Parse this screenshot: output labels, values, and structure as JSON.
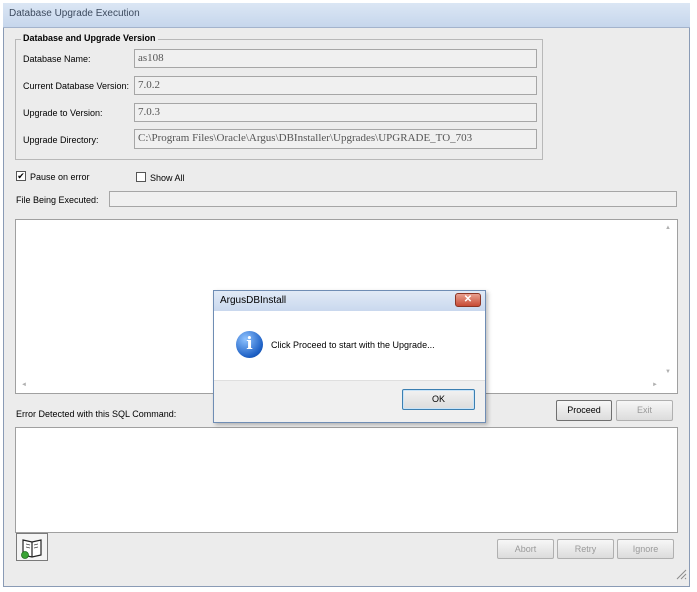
{
  "window": {
    "title": "Database Upgrade Execution"
  },
  "group": {
    "legend": "Database and Upgrade Version",
    "fields": [
      {
        "label": "Database Name:",
        "value": "as108"
      },
      {
        "label": "Current Database Version:",
        "value": "7.0.2"
      },
      {
        "label": "Upgrade to Version:",
        "value": "7.0.3"
      },
      {
        "label": "Upgrade Directory:",
        "value": "C:\\Program Files\\Oracle\\Argus\\DBInstaller\\Upgrades\\UPGRADE_TO_703"
      }
    ]
  },
  "options": {
    "pause_on_error": {
      "label": "Pause on error",
      "checked": true,
      "mark": "✔"
    },
    "show_all": {
      "label": "Show All",
      "checked": false
    }
  },
  "file_being_executed": {
    "label": "File Being Executed:",
    "value": ""
  },
  "error_section": {
    "label": "Error Detected with this SQL Command:"
  },
  "buttons": {
    "proceed": "Proceed",
    "exit": "Exit",
    "abort": "Abort",
    "retry": "Retry",
    "ignore": "Ignore"
  },
  "dialog": {
    "title": "ArgusDBInstall",
    "close": "✕",
    "icon": "info-icon",
    "icon_glyph": "i",
    "message": "Click Proceed to start with the Upgrade...",
    "ok": "OK"
  },
  "scroll_glyphs": {
    "up": "▲",
    "down": "▼",
    "left": "◄",
    "right": "►"
  },
  "icons": {
    "help": "book-icon",
    "resize": "resize-grip-icon"
  },
  "colors": {
    "window_bg": "#ececec",
    "title_gradient_top": "#dbe6f4",
    "close_red": "#c74a34"
  }
}
